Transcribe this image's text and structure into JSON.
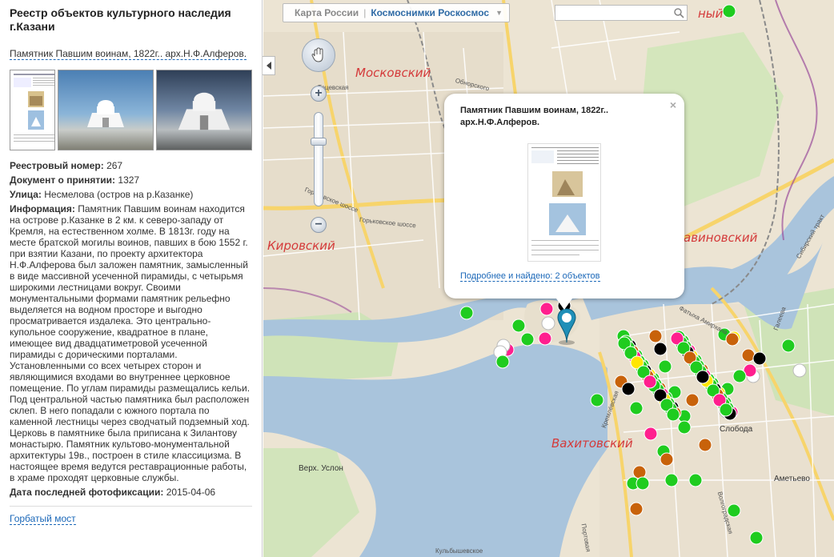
{
  "sidebar": {
    "title": "Реестр объектов культурного наследия г.Казани",
    "object_link": "Памятник Павшим воинам, 1822г.. арх.Н.Ф.Алферов.",
    "fields": {
      "registry_label": "Реестровый номер:",
      "registry_value": " 267",
      "document_label": "Документ о принятии:",
      "document_value": " 1327",
      "street_label": "Улица:",
      "street_value": " Несмелова (остров на р.Казанке)",
      "info_label": "Информация:",
      "info_value": " Памятник Павшим воинам находится на острове р.Казанке в 2 км. к северо-западу от Кремля, на естественном холме. В 1813г. году на месте братской могилы воинов, павших в бою 1552 г. при взятии Казани, по проекту архитектора Н.Ф.Алферова был заложен памятник, замысленный в виде массивной усеченной пирамиды, с четырьмя широкими лестницами вокруг. Своими монументальными формами памятник рельефно выделяется на водном просторе и выгодно просматривается издалека. Это центрально-купольное сооружение, квадратное в плане, имеющее вид двадцатиметровой усеченной пирамиды с дорическими порталами. Установленными со всех четырех сторон и являющимися входами во внутреннее церковное помещение. По углам пирамиды размещались кельи. Под центральной частью памятника был расположен склеп. В него попадали с южного портала по каменной лестницы через сводчатый подземный ход. Церковь в памятнике была приписана к Зилантову монастырю. Памятник культово-монументальной архитектуры 19в., построен в стиле классицизма. В настоящее время ведутся реставрационные работы, в храме проходят церковные службы.",
      "photo_date_label": "Дата последней фотофиксации:",
      "photo_date_value": " 2015-04-06"
    },
    "next_link": "Горбатый мост"
  },
  "map": {
    "tabs": [
      "Карта России",
      "Космоснимки Роскосмос"
    ],
    "search_placeholder": "",
    "districts": [
      "Московский",
      "Кировский",
      "Вахитовский",
      "авиновский",
      "ный"
    ],
    "places": [
      "Верх. Услон",
      "Слобода",
      "Аметьево"
    ],
    "streets": [
      "Тэцевская",
      "Обнорского",
      "Горьковское шоссе",
      "Горьковское шоссе",
      "Фатыха Амирхана",
      "Галеева",
      "Сибирский тракт",
      "Кремлёвская",
      "Портовая",
      "Волгоградская",
      "Кульбышевское"
    ],
    "popup": {
      "title": "Памятник Павшим воинам, 1822г.. арх.Н.Ф.Алферов.",
      "link": "Подробнее и найдено: 2 объектов",
      "close": "×"
    },
    "marker_colors": {
      "green": "#1fcc1f",
      "magenta": "#ff1f8e",
      "black": "#000000",
      "brown": "#c8620a",
      "white": "#ffffff",
      "yellow": "#ffe600"
    }
  }
}
